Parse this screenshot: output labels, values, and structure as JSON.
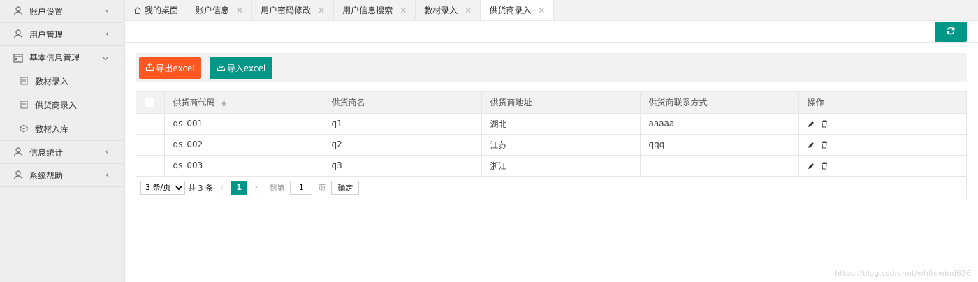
{
  "sidebar": {
    "items": [
      {
        "label": "账户设置",
        "icon": "user-icon",
        "arrow": "‹"
      },
      {
        "label": "用户管理",
        "icon": "user-icon",
        "arrow": "‹"
      },
      {
        "label": "基本信息管理",
        "icon": "calendar-icon",
        "arrow": "⌄",
        "children": [
          {
            "label": "教材录入",
            "icon": "doc-icon"
          },
          {
            "label": "供货商录入",
            "icon": "doc-icon"
          },
          {
            "label": "教材入库",
            "icon": "box-icon"
          }
        ]
      },
      {
        "label": "信息统计",
        "icon": "user-icon",
        "arrow": "‹"
      },
      {
        "label": "系统帮助",
        "icon": "user-icon",
        "arrow": "‹"
      }
    ]
  },
  "tabs": [
    {
      "label": "我的桌面",
      "closable": false,
      "icon": "home-icon"
    },
    {
      "label": "账户信息",
      "closable": true
    },
    {
      "label": "用户密码修改",
      "closable": true
    },
    {
      "label": "用户信息搜索",
      "closable": true
    },
    {
      "label": "教材录入",
      "closable": true
    },
    {
      "label": "供货商录入",
      "closable": true,
      "active": true
    }
  ],
  "toolbar": {
    "export_label": "导出excel",
    "import_label": "导入excel"
  },
  "table": {
    "columns": [
      "供货商代码",
      "供货商名",
      "供货商地址",
      "供货商联系方式",
      "操作"
    ],
    "rows": [
      {
        "code": "qs_001",
        "name": "q1",
        "address": "湖北",
        "contact": "aaaaa"
      },
      {
        "code": "qs_002",
        "name": "q2",
        "address": "江苏",
        "contact": "qqq"
      },
      {
        "code": "qs_003",
        "name": "q3",
        "address": "浙江",
        "contact": ""
      }
    ]
  },
  "pagination": {
    "page_size": "3 条/页",
    "total": "共 3 条",
    "current_page": "1",
    "goto_label": "到第",
    "goto_value": "1",
    "page_suffix": "页",
    "confirm_label": "确定"
  },
  "watermark": "https://blog.csdn.net/whitewind626",
  "colors": {
    "primary": "#009688",
    "danger": "#ff5722",
    "sidebar_bg": "#eeeeee"
  }
}
